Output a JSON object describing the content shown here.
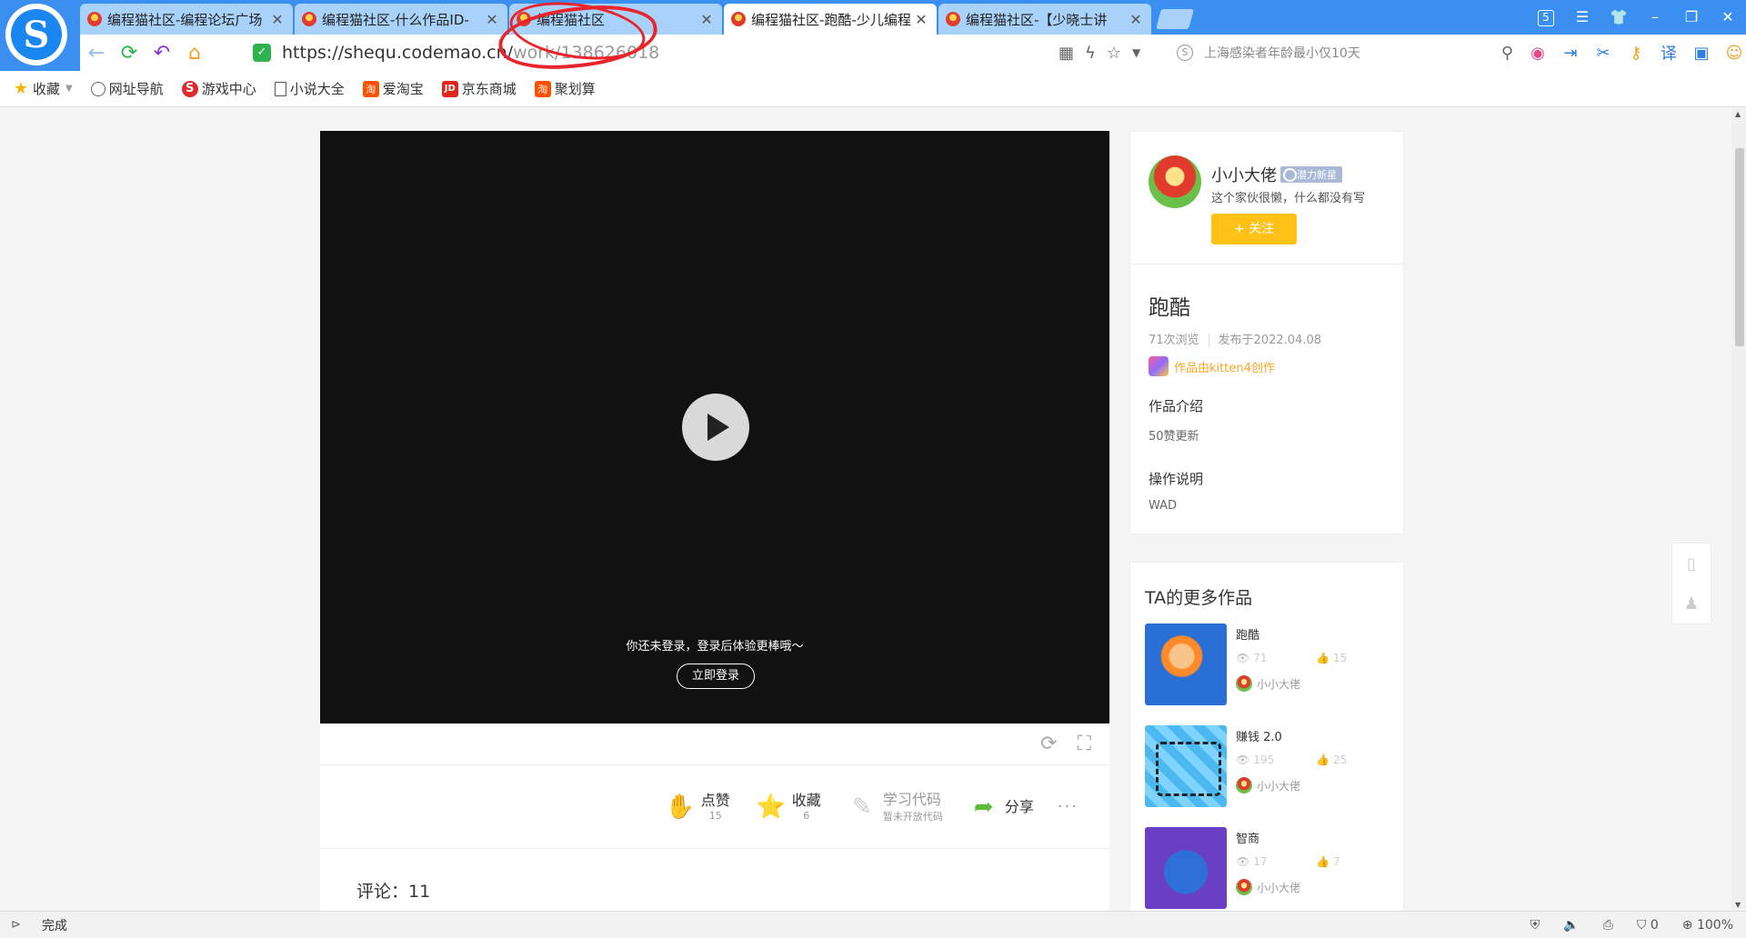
{
  "browser": {
    "tabs": [
      {
        "title": "编程猫社区-编程论坛广场",
        "active": false
      },
      {
        "title": "编程猫社区-什么作品ID-",
        "active": false
      },
      {
        "title": "编程猫社区",
        "active": false
      },
      {
        "title": "编程猫社区-跑酷-少儿编程",
        "active": true
      },
      {
        "title": "编程猫社区-【少晓士讲",
        "active": false
      }
    ],
    "tab_close_glyph": "✕",
    "window_badge": "5",
    "url_main": "https://shequ.codemao.cn/",
    "url_tail": "work/138626018",
    "search_placeholder": "上海感染者年龄最小仅10天",
    "bookmarks": [
      {
        "label": "收藏",
        "icon": "star-icon"
      },
      {
        "label": "网址导航",
        "icon": "globe-icon"
      },
      {
        "label": "游戏中心",
        "icon": "game-icon"
      },
      {
        "label": "小说大全",
        "icon": "book-icon"
      },
      {
        "label": "爱淘宝",
        "icon": "taobao-icon"
      },
      {
        "label": "京东商城",
        "icon": "jd-icon"
      },
      {
        "label": "聚划算",
        "icon": "juhuasuan-icon"
      }
    ],
    "accent": "#3b8ff0"
  },
  "player": {
    "login_tip": "你还未登录，登录后体验更棒哦～",
    "login_button": "立即登录"
  },
  "actions": {
    "like_label": "点赞",
    "like_count": "15",
    "collect_label": "收藏",
    "collect_count": "6",
    "learn_label": "学习代码",
    "learn_sub": "暂未开放代码",
    "share_label": "分享",
    "more": "···"
  },
  "comments": {
    "label": "评论：11"
  },
  "author": {
    "name": "小小大佬",
    "tag": "潜力新星",
    "bio": "这个家伙很懒，什么都没有写",
    "follow": "+ 关注"
  },
  "work": {
    "title": "跑酷",
    "views": "71次浏览",
    "published": "发布于2022.04.08",
    "made_by": "作品由kitten4创作",
    "intro_title": "作品介绍",
    "intro_text": "50赞更新",
    "ops_title": "操作说明",
    "ops_text": "WAD"
  },
  "more_works": {
    "title": "TA的更多作品",
    "items": [
      {
        "title": "跑酷",
        "views": "71",
        "likes": "15",
        "author": "小小大佬"
      },
      {
        "title": "赚钱 2.0",
        "views": "195",
        "likes": "25",
        "author": "小小大佬"
      },
      {
        "title": "智商",
        "views": "17",
        "likes": "7",
        "author": "小小大佬"
      }
    ]
  },
  "status": {
    "left": "完成",
    "blocked": "0",
    "zoom": "100%"
  }
}
